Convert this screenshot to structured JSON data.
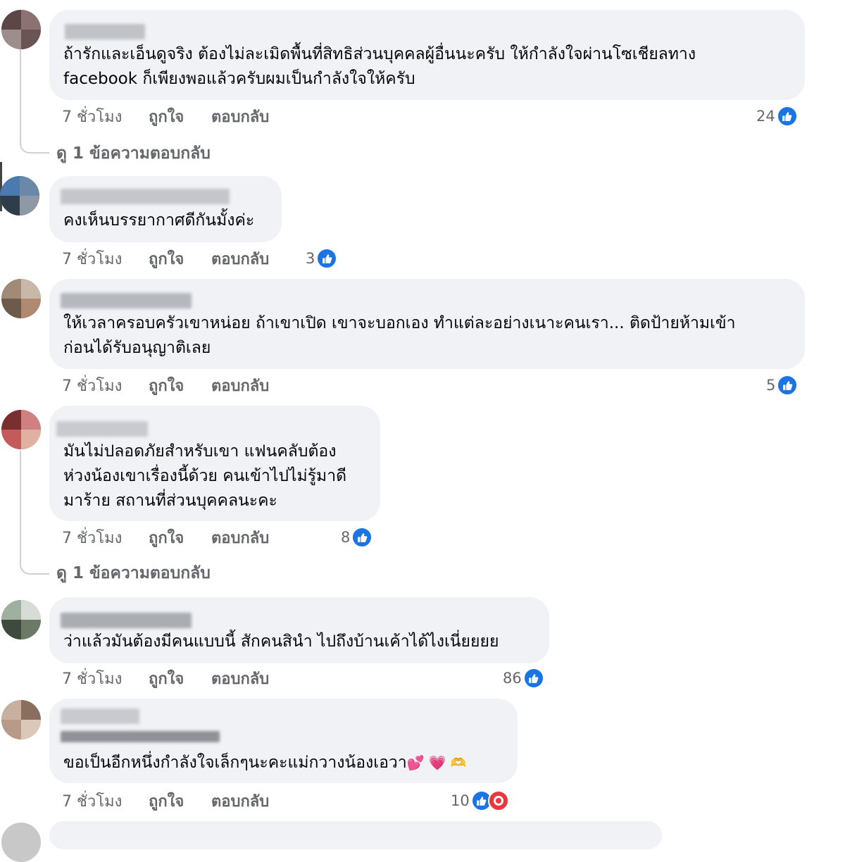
{
  "comments": [
    {
      "text": "ถ้ารักและเอ็นดูจริง ต้องไม่ละเมิดพื้นที่สิทธิส่วนบุคคลผู้อื่นนะครับ ให้กำลังใจผ่านโซเชียลทาง\nfacebook ก็เพียงพอแล้วครับผมเป็นกำลังใจให้ครับ",
      "time": "7 ชั่วโมง",
      "like_label": "ถูกใจ",
      "reply_label": "ตอบกลับ",
      "reaction_count": "24",
      "reaction_icon": "like-icon"
    },
    {
      "text": "คงเห็นบรรยากาศดีกันมั้งค่ะ",
      "time": "7 ชั่วโมง",
      "like_label": "ถูกใจ",
      "reply_label": "ตอบกลับ",
      "reaction_count": "3",
      "reaction_icon": "like-icon"
    },
    {
      "text": "ให้เวลาครอบครัวเขาหน่อย ถ้าเขาเปิด เขาจะบอกเอง ทำแต่ละอย่างเนาะคนเรา... ติดป้ายห้ามเข้า\nก่อนได้รับอนุญาติเลย",
      "time": "7 ชั่วโมง",
      "like_label": "ถูกใจ",
      "reply_label": "ตอบกลับ",
      "reaction_count": "5",
      "reaction_icon": "like-icon"
    },
    {
      "text": "มันไม่ปลอดภัยสำหรับเขา แฟนคลับต้อง\nห่วงน้องเขาเรื่องนี้ด้วย คนเข้าไปไม่รู้มาดี\nมาร้าย สถานที่ส่วนบุคคลนะคะ",
      "time": "7 ชั่วโมง",
      "like_label": "ถูกใจ",
      "reply_label": "ตอบกลับ",
      "reaction_count": "8",
      "reaction_icon": "like-icon"
    },
    {
      "text": "ว่าแล้วมันต้องมีคนแบบนี้ สักคนสินำ ไปถึงบ้านเค้าได้ไงเนี่ยยยย",
      "time": "7 ชั่วโมง",
      "like_label": "ถูกใจ",
      "reply_label": "ตอบกลับ",
      "reaction_count": "86",
      "reaction_icon": "like-icon"
    },
    {
      "text": "ขอเป็นอีกหนึ่งกำลังใจเล็กๆนะคะแม่กวางน้องเอวา",
      "emojis": [
        "💕",
        "💗",
        "🫶"
      ],
      "time": "7 ชั่วโมง",
      "like_label": "ถูกใจ",
      "reply_label": "ตอบกลับ",
      "reaction_count": "10",
      "reaction_icon": "like-icon",
      "reaction_icon_2": "haha-icon"
    }
  ],
  "view_replies": [
    "ดู 1 ข้อความตอบกลับ",
    "ดู 1 ข้อความตอบกลับ"
  ],
  "colors": {
    "bubble": "#f0f2f5",
    "meta_text": "#65676b",
    "like_blue": "#1b74e4",
    "haha_red": "#e9363f"
  }
}
